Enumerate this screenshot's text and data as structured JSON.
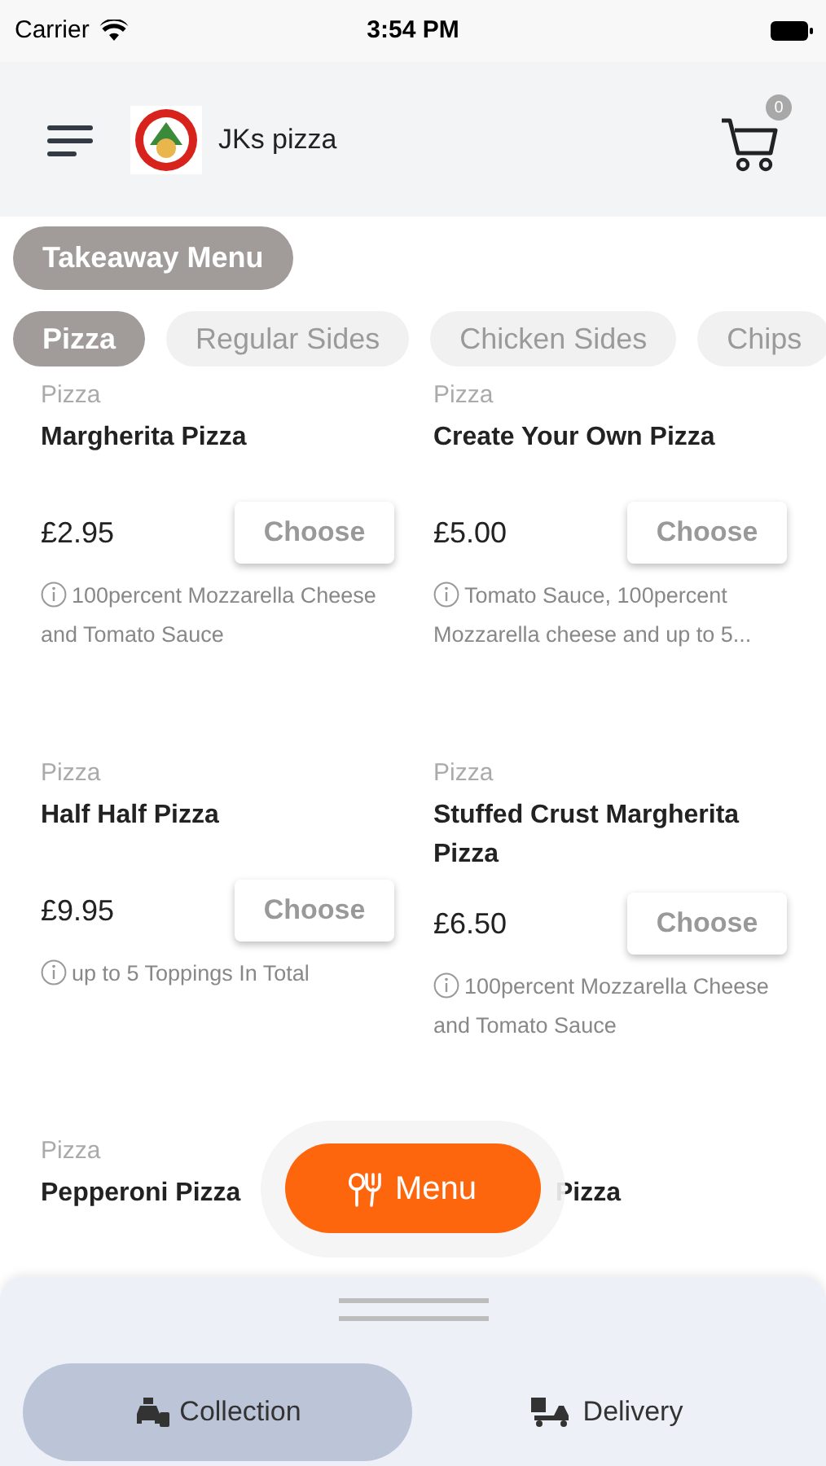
{
  "status_bar": {
    "carrier": "Carrier",
    "time": "3:54 PM"
  },
  "header": {
    "title": "JKs pizza",
    "cart_count": "0"
  },
  "menu_title": "Takeaway Menu",
  "categories": [
    {
      "label": "Pizza",
      "selected": true
    },
    {
      "label": "Regular Sides",
      "selected": false
    },
    {
      "label": "Chicken Sides",
      "selected": false
    },
    {
      "label": "Chips",
      "selected": false
    }
  ],
  "items": [
    {
      "kind": "full",
      "category": "Pizza",
      "name": "Margherita Pizza",
      "price": "£2.95",
      "button": "Choose",
      "description": "100percent Mozzarella Cheese and Tomato Sauce"
    },
    {
      "kind": "full",
      "category": "Pizza",
      "name": "Create Your Own Pizza",
      "price": "£5.00",
      "button": "Choose",
      "description": "Tomato Sauce, 100percent Mozzarella cheese and up to 5..."
    },
    {
      "kind": "full",
      "category": "Pizza",
      "name": "Half Half Pizza",
      "price": "£9.95",
      "button": "Choose",
      "description": "up to 5 Toppings In Total"
    },
    {
      "kind": "full",
      "category": "Pizza",
      "name": "Stuffed Crust Margherita Pizza",
      "price": "£6.50",
      "button": "Choose",
      "description": "100percent Mozzarella Cheese and Tomato Sauce"
    },
    {
      "kind": "cut",
      "category": "Pizza",
      "name": "Pepperoni Pizza"
    },
    {
      "kind": "covered",
      "name": "Pizza"
    }
  ],
  "menu_button": "Menu",
  "order_modes": [
    {
      "label": "Collection",
      "selected": true,
      "kind": "collection"
    },
    {
      "label": "Delivery",
      "selected": false,
      "kind": "delivery"
    }
  ]
}
